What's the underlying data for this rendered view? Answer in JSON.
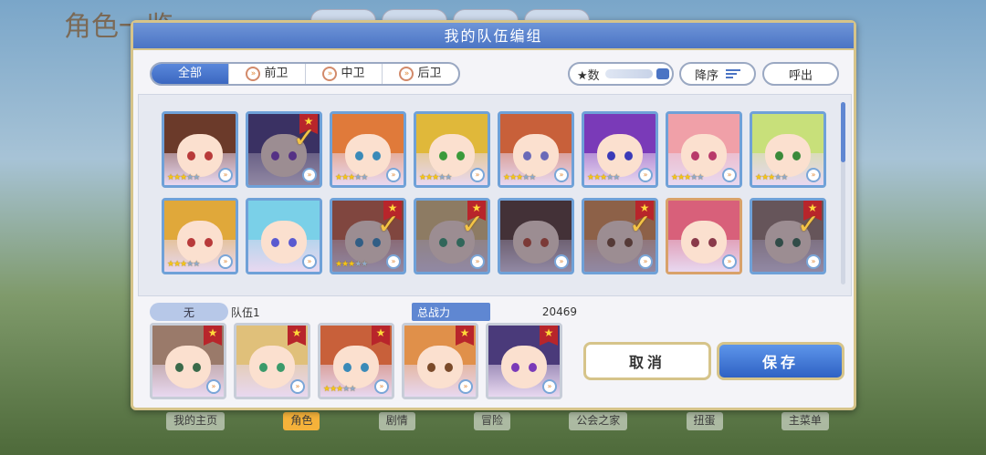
{
  "background": {
    "title": "角色一览",
    "bottom_nav": [
      {
        "label": "我的主页",
        "active": false
      },
      {
        "label": "角色",
        "active": true
      },
      {
        "label": "剧情",
        "active": false
      },
      {
        "label": "冒险",
        "active": false
      },
      {
        "label": "公会之家",
        "active": false
      },
      {
        "label": "扭蛋",
        "active": false
      },
      {
        "label": "主菜单",
        "active": false
      }
    ]
  },
  "dialog": {
    "title": "我的队伍编组",
    "filters": [
      {
        "label": "全部",
        "active": true
      },
      {
        "label": "前卫",
        "active": false
      },
      {
        "label": "中卫",
        "active": false
      },
      {
        "label": "后卫",
        "active": false
      }
    ],
    "sort_key_label": "★数",
    "sort_order_label": "降序",
    "call_out_label": "呼出",
    "roster": [
      {
        "stars": 3,
        "max": 5,
        "selected": false,
        "hair": "#6b3a2a",
        "eye": "#b83a3a",
        "dim": false,
        "rank_badge": false
      },
      {
        "stars": 0,
        "max": 5,
        "selected": true,
        "hair": "#4a3a7a",
        "eye": "#7a3ab8",
        "dim": true,
        "rank_badge": true
      },
      {
        "stars": 3,
        "max": 5,
        "selected": false,
        "hair": "#e07a3a",
        "eye": "#3a8ab8",
        "dim": false,
        "rank_badge": false
      },
      {
        "stars": 3,
        "max": 5,
        "selected": false,
        "hair": "#e0b83a",
        "eye": "#3a9a3a",
        "dim": false,
        "rank_badge": false
      },
      {
        "stars": 3,
        "max": 5,
        "selected": false,
        "hair": "#c8603a",
        "eye": "#6a6ab8",
        "dim": false,
        "rank_badge": false
      },
      {
        "stars": 3,
        "max": 5,
        "selected": false,
        "hair": "#7a3ab8",
        "eye": "#3a3ab8",
        "dim": false,
        "rank_badge": false
      },
      {
        "stars": 3,
        "max": 5,
        "selected": false,
        "hair": "#f0a0a8",
        "eye": "#b83a6a",
        "dim": false,
        "rank_badge": false
      },
      {
        "stars": 3,
        "max": 5,
        "selected": false,
        "hair": "#c8e07a",
        "eye": "#3a8a3a",
        "dim": false,
        "rank_badge": false
      },
      {
        "stars": 3,
        "max": 5,
        "selected": false,
        "hair": "#e0a83a",
        "eye": "#b83a3a",
        "dim": false,
        "rank_badge": false
      },
      {
        "stars": 0,
        "max": 5,
        "selected": false,
        "hair": "#7ad0e8",
        "eye": "#5a5ad0",
        "dim": false,
        "rank_badge": false
      },
      {
        "stars": 3,
        "max": 5,
        "selected": true,
        "hair": "#c8603a",
        "eye": "#3a8ab8",
        "dim": true,
        "rank_badge": true
      },
      {
        "stars": 0,
        "max": 5,
        "selected": true,
        "hair": "#e0c07a",
        "eye": "#3a9a6a",
        "dim": true,
        "rank_badge": true
      },
      {
        "stars": 0,
        "max": 5,
        "selected": false,
        "hair": "#5a3a2a",
        "eye": "#c04a2a",
        "dim": true,
        "rank_badge": false
      },
      {
        "stars": 0,
        "max": 5,
        "selected": true,
        "hair": "#e0904a",
        "eye": "#7a4a2a",
        "dim": true,
        "rank_badge": true
      },
      {
        "stars": 0,
        "max": 5,
        "selected": false,
        "hair": "#d8607a",
        "eye": "#8a3a4a",
        "dim": false,
        "rank_badge": false,
        "gold": true
      },
      {
        "stars": 0,
        "max": 5,
        "selected": true,
        "hair": "#9a7a6a",
        "eye": "#3a6a4a",
        "dim": true,
        "rank_badge": true
      }
    ],
    "team": {
      "slot_label": "无",
      "name": "队伍1",
      "power_label": "总战力",
      "power_value": "20469",
      "members": [
        {
          "stars": 0,
          "hair": "#9a7a6a",
          "eye": "#3a6a4a"
        },
        {
          "stars": 0,
          "hair": "#e0c07a",
          "eye": "#3a9a6a"
        },
        {
          "stars": 3,
          "hair": "#c8603a",
          "eye": "#3a8ab8"
        },
        {
          "stars": 0,
          "hair": "#e0904a",
          "eye": "#7a4a2a"
        },
        {
          "stars": 0,
          "hair": "#4a3a7a",
          "eye": "#7a3ab8"
        }
      ]
    },
    "cancel_label": "取消",
    "save_label": "保存"
  },
  "colors": {
    "header_blue": "#4b74c4",
    "accent_gold": "#d6c48a",
    "badge_red": "#b8252b"
  }
}
